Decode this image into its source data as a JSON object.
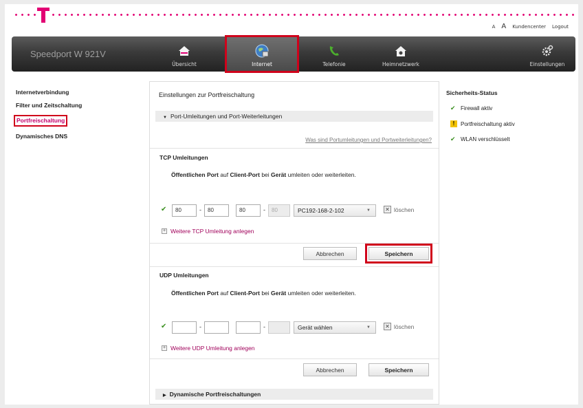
{
  "header": {
    "links": [
      "A",
      "A",
      "Kundencenter",
      "Logout"
    ],
    "model": "Speedport W 921V"
  },
  "nav": [
    {
      "label": "Übersicht",
      "icon": "house-icon"
    },
    {
      "label": "Internet",
      "icon": "globe-icon",
      "active": true
    },
    {
      "label": "Telefonie",
      "icon": "phone-icon"
    },
    {
      "label": "Heimnetzwerk",
      "icon": "home-network-icon"
    },
    {
      "label": "Einstellungen",
      "icon": "gear-icon"
    }
  ],
  "sidebar": {
    "items": [
      "Internetverbindung",
      "Filter und Zeitschaltung",
      "Portfreischaltung",
      "Dynamisches DNS"
    ]
  },
  "panel": {
    "title": "Einstellungen zur Portfreischaltung",
    "section1": "Port-Umleitungen und Port-Weiterleitungen",
    "help_link": "Was sind Portumleitungen und Portweiterleitungen?",
    "tcp": {
      "heading": "TCP Umleitungen",
      "desc_1": "Öffentlichen Port",
      "desc_2": " auf ",
      "desc_3": "Client-Port",
      "desc_4": " bei ",
      "desc_5": "Gerät",
      "desc_6": " umleiten oder weiterleiten.",
      "port_from": "80",
      "port_to": "80",
      "client_from": "80",
      "client_to": "80",
      "device": "PC192-168-2-102",
      "delete": "löschen",
      "add": "Weitere TCP Umleitung anlegen",
      "cancel": "Abbrechen",
      "save": "Speichern"
    },
    "udp": {
      "heading": "UDP Umleitungen",
      "desc_1": "Öffentlichen Port",
      "desc_2": " auf ",
      "desc_3": "Client-Port",
      "desc_4": " bei ",
      "desc_5": "Gerät",
      "desc_6": " umleiten oder weiterleiten.",
      "port_from": "",
      "port_to": "",
      "client_from": "",
      "client_to": "",
      "device": "Gerät wählen",
      "delete": "löschen",
      "add": "Weitere UDP Umleitung anlegen",
      "cancel": "Abbrechen",
      "save": "Speichern"
    },
    "section2": "Dynamische Portfreischaltungen"
  },
  "status": {
    "title": "Sicherheits-Status",
    "items": [
      {
        "label": "Firewall aktiv",
        "icon": "check-icon"
      },
      {
        "label": "Portfreischaltung aktiv",
        "icon": "warning-icon"
      },
      {
        "label": "WLAN verschlüsselt",
        "icon": "check-icon"
      }
    ]
  },
  "colors": {
    "brand": "#e20074",
    "highlight": "#d0021b",
    "ok": "#3a8f1f"
  }
}
